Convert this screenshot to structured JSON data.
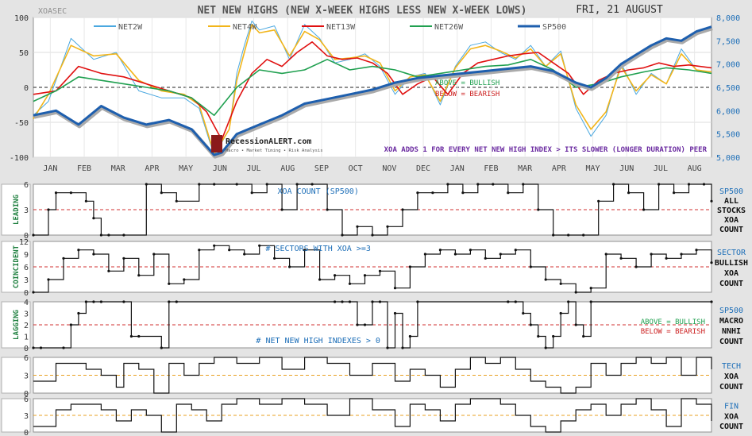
{
  "header": {
    "ticker": "XOASEC",
    "title": "NET NEW HIGHS (NEW X-WEEK HIGHS LESS NEW X-WEEK LOWS)",
    "date": "FRI, 21 AUGUST",
    "logo_text": "RecessionALERT.com",
    "logo_sub": "Macro • Market Timing • Risk Analysis",
    "note": "XOA ADDS 1 FOR EVERY NET NEW HIGH INDEX > ITS SLOWER (LONGER DURATION) PEER"
  },
  "colors": {
    "bg": "#e4e4e4",
    "panel": "#ffffff",
    "net2w": "#4aa8e0",
    "net4w": "#f2b51a",
    "net13w": "#e01010",
    "net26w": "#20a050",
    "sp500": "#1e5fae",
    "bullish": "#20a050",
    "bearish": "#cc2020",
    "threshold": "#d03030",
    "orange_dash": "#e8a020",
    "label_blue": "#1e6fb8",
    "label_green": "#208040",
    "note_purple": "#6a2aa0"
  },
  "chart_data": [
    {
      "type": "line",
      "panel": "main",
      "x_ticks": [
        "JAN",
        "FEB",
        "MAR",
        "APR",
        "MAY",
        "JUN",
        "JUL",
        "AUG",
        "SEP",
        "OCT",
        "NOV",
        "DEC",
        "JAN",
        "FEB",
        "MAR",
        "APR",
        "MAY",
        "JUN",
        "JUL",
        "AUG"
      ],
      "ylim": [
        -100,
        100
      ],
      "yticks": [
        -100,
        -50,
        0,
        50,
        100
      ],
      "y2lim": [
        5000,
        8000
      ],
      "y2ticks": [
        5000,
        5500,
        6000,
        6500,
        7000,
        7500,
        8000
      ],
      "y2ticks_label": [
        "5,000",
        "5,500",
        "6,000",
        "6,500",
        "7,000",
        "7,500",
        "8,000"
      ],
      "annotations": {
        "above": "ABOVE = BULLISH",
        "below": "BELOW = BEARISH"
      },
      "series": [
        {
          "name": "NET2W",
          "color_key": "net2w",
          "axis": "left",
          "width": 1.0,
          "x": [
            0,
            2,
            5,
            8,
            11,
            14,
            17,
            20,
            22,
            24,
            26,
            27,
            28,
            29,
            30,
            32,
            34,
            36,
            38,
            40,
            42,
            44,
            46,
            48,
            50,
            52,
            54,
            56,
            58,
            60,
            62,
            64,
            66,
            68,
            70,
            72,
            74,
            76,
            78,
            80,
            82,
            84,
            86,
            88,
            90
          ],
          "y": [
            -40,
            -20,
            70,
            40,
            50,
            -5,
            -15,
            -15,
            -30,
            -98,
            -60,
            20,
            60,
            95,
            82,
            88,
            40,
            90,
            70,
            35,
            40,
            48,
            30,
            -10,
            15,
            20,
            -25,
            30,
            60,
            65,
            50,
            40,
            60,
            30,
            52,
            -30,
            -70,
            -40,
            35,
            -10,
            20,
            5,
            55,
            25,
            22
          ]
        },
        {
          "name": "NET4W",
          "color_key": "net4w",
          "axis": "left",
          "width": 1.6,
          "x": [
            0,
            2,
            5,
            8,
            11,
            14,
            17,
            20,
            22,
            24,
            26,
            27,
            28,
            29,
            30,
            32,
            34,
            36,
            38,
            40,
            42,
            44,
            46,
            48,
            50,
            52,
            54,
            56,
            58,
            60,
            62,
            64,
            66,
            68,
            70,
            72,
            74,
            76,
            78,
            80,
            82,
            84,
            86,
            88,
            90
          ],
          "y": [
            -45,
            -10,
            60,
            45,
            48,
            10,
            -5,
            -10,
            -25,
            -95,
            -60,
            10,
            50,
            90,
            78,
            82,
            45,
            80,
            68,
            40,
            42,
            45,
            35,
            -5,
            15,
            18,
            -20,
            28,
            55,
            60,
            52,
            42,
            55,
            30,
            48,
            -25,
            -60,
            -35,
            30,
            -5,
            18,
            5,
            48,
            25,
            22
          ]
        },
        {
          "name": "NET13W",
          "color_key": "net13w",
          "axis": "left",
          "width": 1.6,
          "x": [
            0,
            3,
            6,
            9,
            12,
            15,
            18,
            21,
            23,
            25,
            27,
            29,
            31,
            33,
            35,
            37,
            39,
            41,
            43,
            45,
            47,
            49,
            51,
            53,
            55,
            57,
            59,
            61,
            63,
            65,
            67,
            69,
            71,
            73,
            75,
            77,
            79,
            81,
            83,
            85,
            87,
            90
          ],
          "y": [
            -10,
            -5,
            30,
            20,
            15,
            5,
            -5,
            -15,
            -35,
            -75,
            -20,
            20,
            40,
            30,
            50,
            65,
            45,
            40,
            42,
            35,
            20,
            -10,
            5,
            15,
            -10,
            20,
            35,
            40,
            45,
            48,
            50,
            35,
            20,
            -10,
            10,
            20,
            25,
            28,
            35,
            30,
            32,
            28
          ]
        },
        {
          "name": "NET26W",
          "color_key": "net26w",
          "axis": "left",
          "width": 1.6,
          "x": [
            0,
            3,
            6,
            9,
            12,
            15,
            18,
            21,
            24,
            27,
            30,
            33,
            36,
            39,
            42,
            45,
            48,
            51,
            54,
            57,
            60,
            63,
            66,
            69,
            72,
            75,
            78,
            81,
            84,
            87,
            90
          ],
          "y": [
            -20,
            -5,
            15,
            10,
            5,
            0,
            -5,
            -15,
            -40,
            0,
            25,
            20,
            25,
            40,
            25,
            30,
            25,
            15,
            20,
            25,
            30,
            32,
            40,
            25,
            0,
            5,
            15,
            22,
            28,
            25,
            20
          ]
        },
        {
          "name": "SP500",
          "color_key": "sp500",
          "axis": "right",
          "width": 3.0,
          "x": [
            0,
            3,
            6,
            9,
            12,
            15,
            18,
            21,
            24,
            25,
            27,
            30,
            33,
            36,
            39,
            42,
            45,
            48,
            51,
            54,
            57,
            60,
            63,
            66,
            69,
            72,
            74,
            76,
            78,
            80,
            82,
            84,
            86,
            88,
            90
          ],
          "y": [
            5900,
            6000,
            5700,
            6100,
            5850,
            5700,
            5800,
            5600,
            5050,
            5100,
            5500,
            5700,
            5900,
            6150,
            6250,
            6350,
            6450,
            6600,
            6700,
            6750,
            6800,
            6850,
            6900,
            6950,
            6850,
            6600,
            6500,
            6700,
            7000,
            7200,
            7400,
            7550,
            7500,
            7700,
            7800
          ]
        }
      ]
    },
    {
      "type": "line",
      "panel": "leading",
      "title": "XOA COUNT (SP500)",
      "side_label": "LEADING",
      "right_labels": [
        "SP500",
        "ALL",
        "STOCKS",
        "XOA",
        "COUNT"
      ],
      "ylim": [
        0,
        6
      ],
      "yticks": [
        0,
        3,
        6
      ],
      "threshold": 3,
      "x": [
        0,
        2,
        3,
        5,
        7,
        8,
        9,
        10,
        12,
        15,
        17,
        19,
        22,
        24,
        27,
        29,
        31,
        33,
        35,
        37,
        39,
        41,
        43,
        45,
        47,
        49,
        51,
        53,
        55,
        57,
        59,
        61,
        63,
        65,
        67,
        69,
        71,
        73,
        75,
        77,
        79,
        81,
        83,
        85,
        87,
        89,
        90
      ],
      "y": [
        0,
        3,
        5,
        5,
        4,
        2,
        0,
        0,
        0,
        6,
        5,
        4,
        6,
        6,
        6,
        5,
        6,
        3,
        6,
        6,
        3,
        0,
        1,
        0,
        1,
        3,
        5,
        5,
        6,
        5,
        6,
        6,
        5,
        6,
        3,
        0,
        0,
        0,
        4,
        6,
        5,
        3,
        6,
        5,
        6,
        6,
        4
      ]
    },
    {
      "type": "line",
      "panel": "coincident",
      "title": "# SECTORS WITH XOA >=3",
      "side_label": "COINCIDENT",
      "right_labels": [
        "SECTOR",
        "BULLISH",
        "XOA",
        "COUNT"
      ],
      "ylim": [
        0,
        12
      ],
      "yticks": [
        0,
        3,
        6,
        9,
        12
      ],
      "threshold": 6,
      "x": [
        0,
        2,
        4,
        6,
        8,
        10,
        12,
        14,
        16,
        18,
        20,
        22,
        24,
        26,
        28,
        30,
        32,
        34,
        36,
        38,
        40,
        42,
        44,
        46,
        48,
        50,
        52,
        54,
        56,
        58,
        60,
        62,
        64,
        66,
        68,
        70,
        72,
        74,
        76,
        78,
        80,
        82,
        84,
        86,
        88,
        90
      ],
      "y": [
        0,
        3,
        8,
        10,
        9,
        5,
        8,
        4,
        9,
        2,
        3,
        10,
        11,
        10,
        9,
        11,
        8,
        6,
        10,
        3,
        4,
        2,
        4,
        5,
        1,
        6,
        9,
        10,
        9,
        10,
        8,
        9,
        10,
        6,
        3,
        2,
        0,
        1,
        9,
        8,
        6,
        9,
        8,
        9,
        10,
        7
      ]
    },
    {
      "type": "line",
      "panel": "lagging",
      "title": "# NET NEW HIGH INDEXES > 0",
      "side_label": "LAGGING",
      "right_labels": [
        "SP500",
        "MACRO",
        "NNHI",
        "COUNT"
      ],
      "annotations": {
        "above": "ABOVE = BULLISH",
        "below": "BELOW = BEARISH"
      },
      "ylim": [
        0,
        4
      ],
      "yticks": [
        0,
        1,
        2,
        3,
        4
      ],
      "threshold": 2,
      "x": [
        0,
        1,
        4,
        5,
        6,
        7,
        8,
        9,
        12,
        13,
        14,
        17,
        18,
        19,
        40,
        41,
        42,
        43,
        44,
        45,
        46,
        47,
        48,
        49,
        50,
        51,
        63,
        64,
        65,
        66,
        67,
        68,
        69,
        70,
        71,
        72,
        73,
        74,
        90
      ],
      "y": [
        0,
        0,
        0,
        2,
        3,
        4,
        4,
        4,
        4,
        1,
        1,
        0,
        4,
        4,
        4,
        4,
        4,
        2,
        2,
        4,
        4,
        0,
        3,
        0,
        1,
        4,
        4,
        4,
        3,
        2,
        1,
        0,
        1,
        3,
        4,
        2,
        1,
        4,
        4
      ]
    },
    {
      "type": "line",
      "panel": "tech",
      "right_labels": [
        "TECH",
        "XOA",
        "COUNT"
      ],
      "ylim": [
        0,
        6
      ],
      "yticks": [
        0,
        3,
        6
      ],
      "threshold": 3,
      "x": [
        0,
        3,
        5,
        7,
        9,
        11,
        12,
        14,
        16,
        18,
        20,
        22,
        24,
        27,
        30,
        33,
        36,
        39,
        42,
        45,
        48,
        50,
        52,
        54,
        56,
        58,
        60,
        62,
        64,
        66,
        68,
        70,
        72,
        74,
        76,
        78,
        80,
        82,
        84,
        86,
        88,
        90
      ],
      "y": [
        2,
        5,
        5,
        4,
        3,
        1,
        5,
        4,
        0,
        5,
        3,
        5,
        6,
        5,
        6,
        4,
        6,
        5,
        3,
        5,
        2,
        4,
        3,
        1,
        4,
        6,
        5,
        6,
        4,
        2,
        1,
        0,
        1,
        5,
        3,
        5,
        6,
        5,
        6,
        3,
        6,
        4
      ]
    },
    {
      "type": "line",
      "panel": "fin",
      "right_labels": [
        "FIN",
        "XOA",
        "COUNT"
      ],
      "ylim": [
        0,
        6
      ],
      "yticks": [
        0,
        3,
        6
      ],
      "threshold": 3,
      "x": [
        0,
        3,
        5,
        7,
        9,
        11,
        13,
        15,
        17,
        19,
        21,
        23,
        25,
        27,
        30,
        33,
        36,
        39,
        42,
        45,
        48,
        50,
        52,
        54,
        56,
        58,
        60,
        62,
        64,
        66,
        68,
        70,
        72,
        74,
        76,
        78,
        80,
        82,
        84,
        86,
        88,
        90
      ],
      "y": [
        1,
        4,
        5,
        5,
        4,
        2,
        4,
        3,
        0,
        5,
        4,
        2,
        5,
        6,
        5,
        6,
        5,
        3,
        6,
        4,
        1,
        5,
        4,
        2,
        5,
        6,
        6,
        5,
        3,
        1,
        0,
        2,
        4,
        5,
        3,
        5,
        6,
        4,
        1,
        6,
        5,
        2
      ]
    }
  ]
}
